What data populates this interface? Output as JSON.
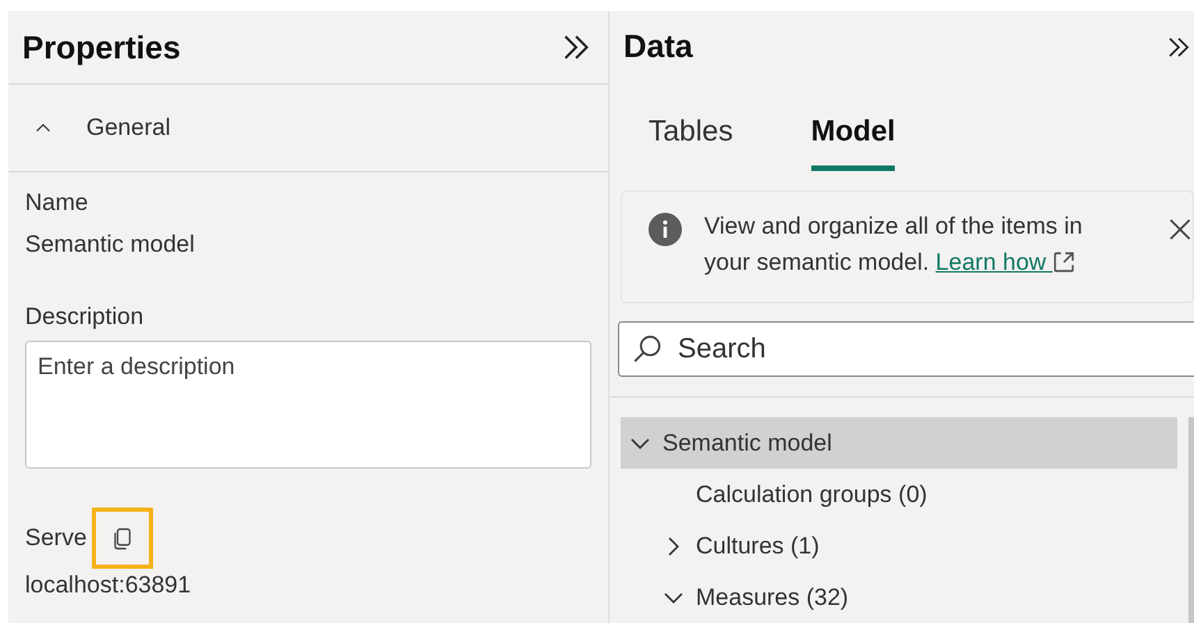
{
  "properties": {
    "title": "Properties",
    "section": {
      "label": "General",
      "expanded": true
    },
    "name_label": "Name",
    "name_value": "Semantic model",
    "description_label": "Description",
    "description_placeholder": "Enter a description",
    "server_label": "Serve",
    "server_copy_highlighted": true,
    "server_value": "localhost:63891"
  },
  "data": {
    "title": "Data",
    "tabs": [
      {
        "label": "Tables",
        "selected": false
      },
      {
        "label": "Model",
        "selected": true
      }
    ],
    "banner": {
      "text": "View and organize all of the items in your semantic model.",
      "link": "Learn how"
    },
    "search": {
      "placeholder": "Search"
    },
    "tree": [
      {
        "label": "Semantic model",
        "expanded": true,
        "selected": true,
        "children": [
          {
            "label": "Calculation groups (0)",
            "selected": false
          },
          {
            "label": "Cultures (1)",
            "expanded": false,
            "selected": false
          },
          {
            "label": "Measures (32)",
            "expanded": true,
            "selected": false
          }
        ]
      }
    ]
  }
}
